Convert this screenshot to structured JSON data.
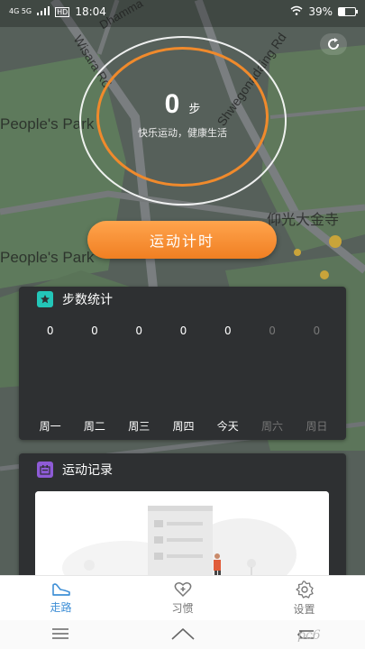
{
  "status_bar": {
    "network": "4G 5G",
    "hd": "HD",
    "time": "18:04",
    "battery_percent": "39%",
    "battery_level": 0.39
  },
  "map": {
    "labels": [
      "Dhamma",
      "Wisara Rd",
      "Shwegonadaing Rd",
      "People's Park",
      "People's Park",
      "仰光大金寺"
    ]
  },
  "steps": {
    "count": "0",
    "unit": "步",
    "slogan": "快乐运动，健康生活"
  },
  "start_button": {
    "label": "运动计时"
  },
  "stats": {
    "title": "步数统计",
    "values": [
      "0",
      "0",
      "0",
      "0",
      "0",
      "0",
      "0"
    ],
    "days": [
      "周一",
      "周二",
      "周三",
      "周四",
      "今天",
      "周六",
      "周日"
    ],
    "dim_from_index": 5
  },
  "records": {
    "title": "运动记录"
  },
  "bottom_nav": {
    "items": [
      {
        "label": "走路",
        "icon": "shoe-icon",
        "active": true
      },
      {
        "label": "习惯",
        "icon": "heart-plus-icon",
        "active": false
      },
      {
        "label": "设置",
        "icon": "gear-icon",
        "active": false
      }
    ]
  },
  "system_nav": {
    "icons": [
      "menu-icon",
      "home-icon",
      "back-icon"
    ]
  },
  "watermark": {
    "text": "pc6"
  },
  "colors": {
    "accent_orange": "#f08a2c",
    "nav_active_blue": "#3f8fd6",
    "stats_icon": "#23c6b8",
    "records_icon": "#8e5bd6",
    "card_bg": "#2e3032"
  }
}
